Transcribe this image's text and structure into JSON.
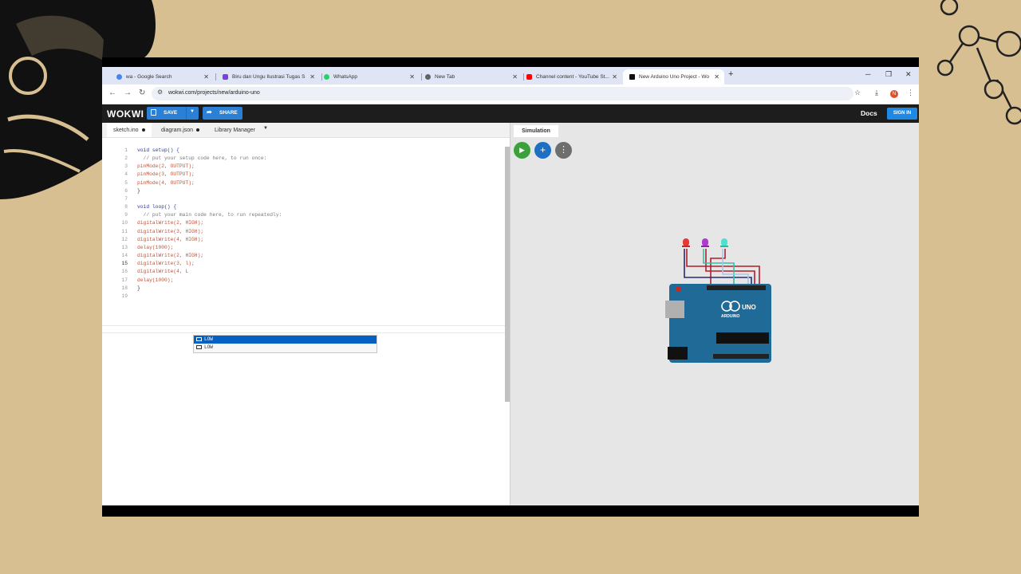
{
  "browser": {
    "tabs": [
      {
        "title": "wa - Google Search",
        "icon": "google-icon",
        "color": "#4285f4",
        "active": false
      },
      {
        "title": "Biru dan Ungu Ilustrasi Tugas S",
        "icon": "canva-icon",
        "color": "#7b3fe4",
        "active": false
      },
      {
        "title": "WhatsApp",
        "icon": "whatsapp-icon",
        "color": "#25d366",
        "active": false
      },
      {
        "title": "New Tab",
        "icon": "chrome-icon",
        "color": "#5f6368",
        "active": false
      },
      {
        "title": "Channel content - YouTube St...",
        "icon": "youtube-icon",
        "color": "#ff0000",
        "active": false
      },
      {
        "title": "New Arduino Uno Project - Wo",
        "icon": "wokwi-icon",
        "color": "#111111",
        "active": true
      }
    ],
    "new_tab": "+",
    "url": "wokwi.com/projects/new/arduino-uno",
    "profile_initial": "N"
  },
  "wokwi": {
    "logo": "WOKWI",
    "save_label": "SAVE",
    "share_label": "SHARE",
    "docs_label": "Docs",
    "signin_label": "SIGN IN",
    "accent": "#2b80d5"
  },
  "editor": {
    "tabs": [
      {
        "label": "sketch.ino",
        "modified": true
      },
      {
        "label": "diagram.json",
        "modified": true
      },
      {
        "label": "Library Manager",
        "dropdown": true
      }
    ],
    "lines": [
      "void setup() {",
      "  // put your setup code here, to run once:",
      "pinMode(2, OUTPUT);",
      "pinMode(3, OUTPUT);",
      "pinMode(4, OUTPUT);",
      "}",
      "",
      "void loop() {",
      "  // put your main code here, to run repeatedly:",
      "digitalWrite(2, HIGH);",
      "digitalWrite(3, HIGH);",
      "digitalWrite(4, HIGH);",
      "delay(1000);",
      "digitalWrite(2, HIGH);",
      "digitalWrite(3, l);",
      "digitalWrite(4, L",
      "delay(1000);",
      "}",
      ""
    ],
    "current_line": 15,
    "autocomplete": [
      "LOW",
      "LOW"
    ]
  },
  "simulation": {
    "tab_label": "Simulation",
    "leds": [
      {
        "color": "#e53935"
      },
      {
        "color": "#b03bd0"
      },
      {
        "color": "#35d6c4"
      }
    ],
    "board_label": "UNO",
    "board_brand": "ARDUINO"
  }
}
